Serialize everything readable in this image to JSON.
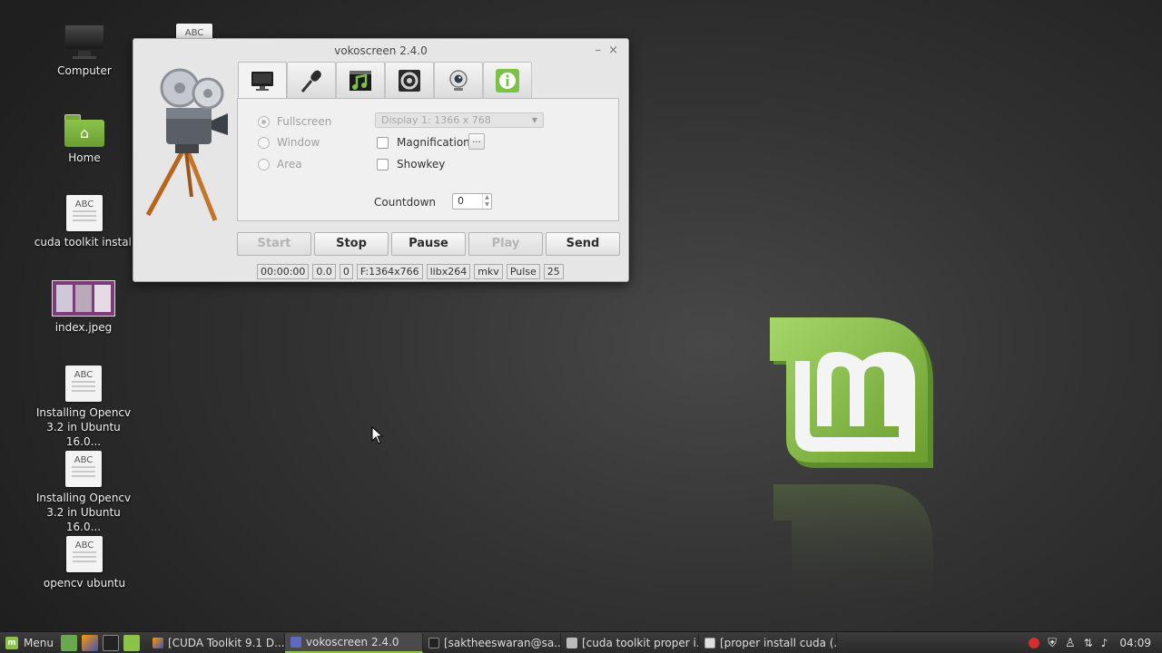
{
  "desktop": {
    "icons": [
      {
        "label": "Computer",
        "icon": "computer-icon"
      },
      {
        "label": "Home",
        "icon": "home-folder-icon"
      },
      {
        "label": "cuda toolkit install",
        "icon": "document-icon",
        "badge": "ABC"
      },
      {
        "label": "index.jpeg",
        "icon": "image-icon"
      },
      {
        "label": "Installing Opencv 3.2 in Ubuntu 16.0...",
        "icon": "document-icon",
        "badge": "ABC"
      },
      {
        "label": "Installing Opencv 3.2 in Ubuntu 16.0...",
        "icon": "document-icon",
        "badge": "ABC"
      },
      {
        "label": "opencv ubuntu",
        "icon": "document-icon",
        "badge": "ABC"
      }
    ],
    "partial_icon_badge": "ABC"
  },
  "window": {
    "title": "vokoscreen 2.4.0",
    "controls": {
      "minimize": "–",
      "close": "×"
    },
    "tabs": [
      {
        "icon": "monitor-icon",
        "active": true
      },
      {
        "icon": "microphone-icon",
        "active": false
      },
      {
        "icon": "video-music-icon",
        "active": false
      },
      {
        "icon": "settings-icon",
        "active": false
      },
      {
        "icon": "webcam-icon",
        "active": false
      },
      {
        "icon": "info-icon",
        "active": false
      }
    ],
    "screen_tab": {
      "radios": [
        {
          "label": "Fullscreen",
          "selected": true
        },
        {
          "label": "Window",
          "selected": false
        },
        {
          "label": "Area",
          "selected": false
        }
      ],
      "display_select": "Display 1:  1366 x 768",
      "magnification_label": "Magnification",
      "magnification_more": "...",
      "showkey_label": "Showkey",
      "countdown_label": "Countdown",
      "countdown_value": "0"
    },
    "buttons": {
      "start": "Start",
      "stop": "Stop",
      "pause": "Pause",
      "play": "Play",
      "send": "Send"
    },
    "status": {
      "time": "00:00:00",
      "fps_rate": "0.0",
      "frames": "0",
      "format": "F:1364x766",
      "codec": "libx264",
      "container": "mkv",
      "audio": "Pulse",
      "fps": "25"
    }
  },
  "taskbar": {
    "menu_label": "Menu",
    "quick_launch": [
      "show-desktop-icon",
      "firefox-icon",
      "terminal-icon",
      "files-icon"
    ],
    "tasks": [
      {
        "label": "[CUDA Toolkit 9.1 D...",
        "icon": "firefox-icon",
        "active": false
      },
      {
        "label": "vokoscreen 2.4.0",
        "icon": "vokoscreen-icon",
        "active": true
      },
      {
        "label": "[saktheeswaran@sa...",
        "icon": "terminal-icon",
        "active": false
      },
      {
        "label": "[cuda toolkit proper i...",
        "icon": "folder-icon",
        "active": false
      },
      {
        "label": "[proper install cuda (...",
        "icon": "text-editor-icon",
        "active": false
      }
    ],
    "tray": [
      "record-icon",
      "shield-icon",
      "user-icon",
      "network-icon",
      "volume-icon"
    ],
    "clock": "04:09"
  },
  "colors": {
    "mint_green": "#8bc34a",
    "record_red": "#d32f2f"
  }
}
